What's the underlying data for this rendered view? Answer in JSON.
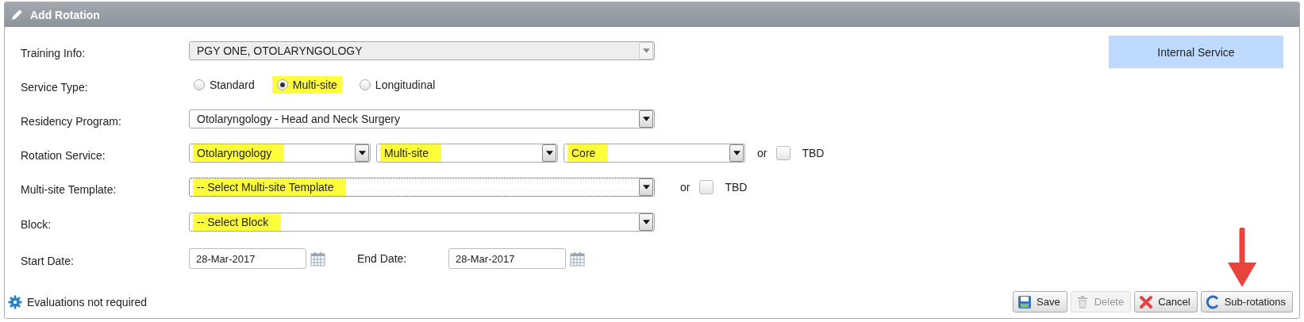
{
  "window": {
    "title": "Add Rotation"
  },
  "fields": [
    {
      "kind": "select",
      "label": "Training Info:",
      "value": "PGY ONE, OTOLARYNGOLOGY",
      "disabled": true,
      "highlighted": false
    },
    {
      "kind": "radio",
      "label": "Service Type:",
      "options": [
        {
          "label": "Standard",
          "selected": false,
          "highlighted": false
        },
        {
          "label": "Multi-site",
          "selected": true,
          "highlighted": true
        },
        {
          "label": "Longitudinal",
          "selected": false,
          "highlighted": false
        }
      ]
    },
    {
      "kind": "select",
      "label": "Residency Program:",
      "value": "Otolaryngology - Head and Neck Surgery",
      "disabled": false,
      "highlighted": false
    },
    {
      "kind": "multi_select",
      "label": "Rotation Service:",
      "selects": [
        {
          "value": "Otolaryngology",
          "highlighted": true
        },
        {
          "value": "Multi-site",
          "highlighted": true
        },
        {
          "value": "Core",
          "highlighted": true
        }
      ],
      "or": "or",
      "tbd": {
        "label": "TBD",
        "checked": false
      }
    },
    {
      "kind": "select",
      "label": "Multi-site Template:",
      "value": "-- Select Multi-site Template",
      "disabled": false,
      "highlighted": true,
      "focused": true,
      "or": "or",
      "tbd": {
        "label": "TBD",
        "checked": false
      }
    },
    {
      "kind": "select",
      "label": "Block:",
      "value": "-- Select Block",
      "disabled": false,
      "highlighted": true
    },
    {
      "kind": "dates",
      "items": [
        {
          "label": "Start Date:",
          "value": "28-Mar-2017"
        },
        {
          "label": "End Date:",
          "value": "28-Mar-2017"
        }
      ]
    }
  ],
  "service_badge": "Internal Service",
  "footer": {
    "note": "Evaluations not required",
    "buttons": [
      {
        "kind": "save",
        "label": "Save",
        "disabled": false
      },
      {
        "kind": "delete",
        "label": "Delete",
        "disabled": true
      },
      {
        "kind": "cancel",
        "label": "Cancel",
        "disabled": false
      },
      {
        "kind": "subrotations",
        "label": "Sub-rotations",
        "disabled": false
      }
    ]
  }
}
